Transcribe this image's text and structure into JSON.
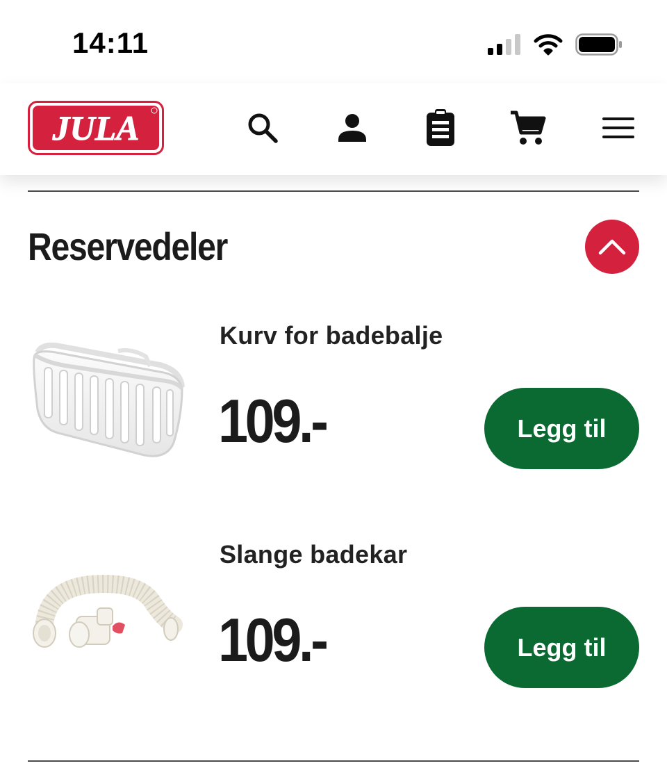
{
  "status_bar": {
    "time": "14:11",
    "icons": [
      "cellular-signal-icon",
      "wifi-icon",
      "battery-icon"
    ]
  },
  "header": {
    "logo_text": "JULA",
    "icons": [
      "search-icon",
      "account-icon",
      "shopping-list-icon",
      "cart-icon",
      "menu-icon"
    ]
  },
  "section": {
    "title": "Reservedeler",
    "toggle_icon": "chevron-up-icon",
    "products": [
      {
        "name": "Kurv for badebalje",
        "price": "109.-",
        "button_label": "Legg til",
        "image": "basket-image"
      },
      {
        "name": "Slange badekar",
        "price": "109.-",
        "button_label": "Legg til",
        "image": "hose-image"
      }
    ]
  },
  "colors": {
    "brand_red": "#d4213d",
    "button_green": "#0a6a32",
    "text_dark": "#1b1b1b"
  }
}
